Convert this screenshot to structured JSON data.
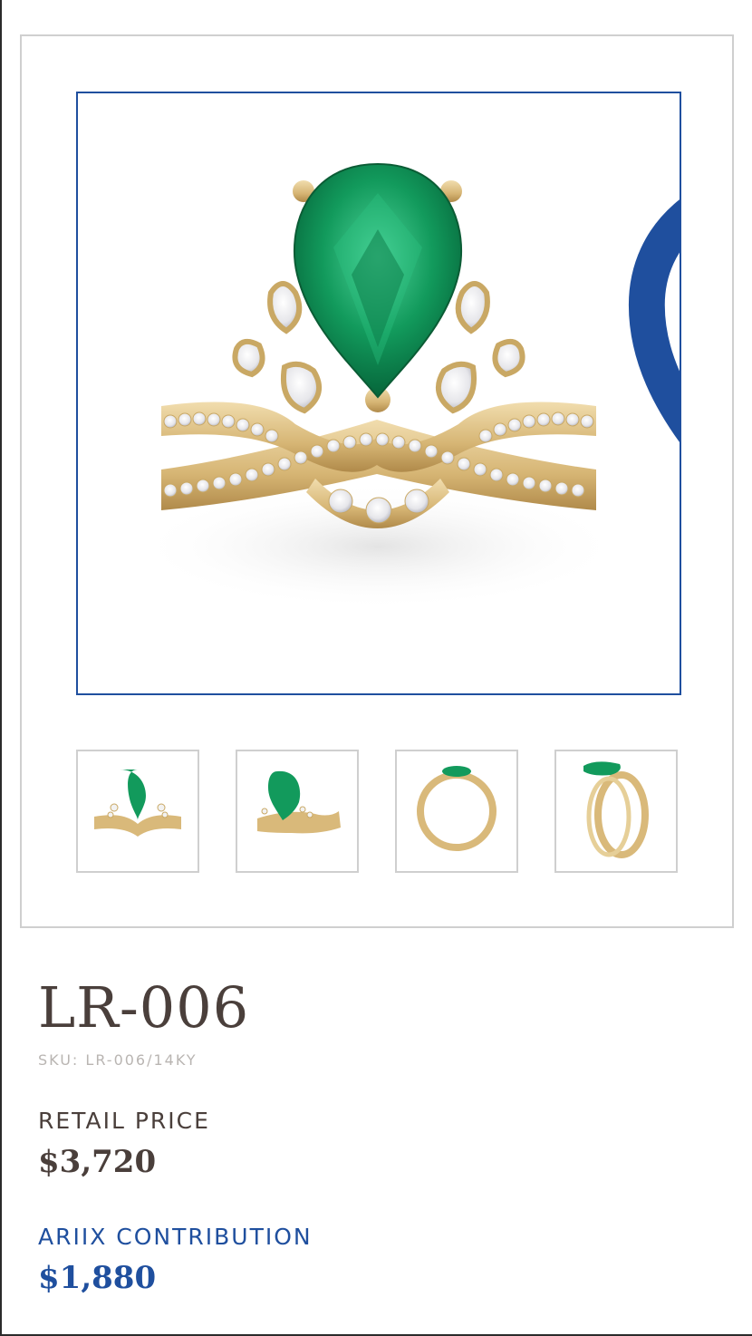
{
  "product": {
    "name": "LR-006",
    "sku": "SKU: LR-006/14KY"
  },
  "pricing": {
    "retail_label": "RETAIL PRICE",
    "retail_price": "$3,720",
    "contribution_label": "ARIIX CONTRIBUTION",
    "contribution_price": "$1,880"
  },
  "gallery": {
    "favorite_icon": "heart-outline-icon",
    "thumbnails": [
      {
        "view": "front"
      },
      {
        "view": "angled"
      },
      {
        "view": "side-profile"
      },
      {
        "view": "perspective"
      }
    ]
  },
  "colors": {
    "accent_blue": "#1f4f9e",
    "text_dark": "#4a3f3b",
    "text_muted": "#b9b5b2",
    "gold": "#d9b97a",
    "emerald": "#12935a",
    "border_gray": "#cfcfcf"
  }
}
